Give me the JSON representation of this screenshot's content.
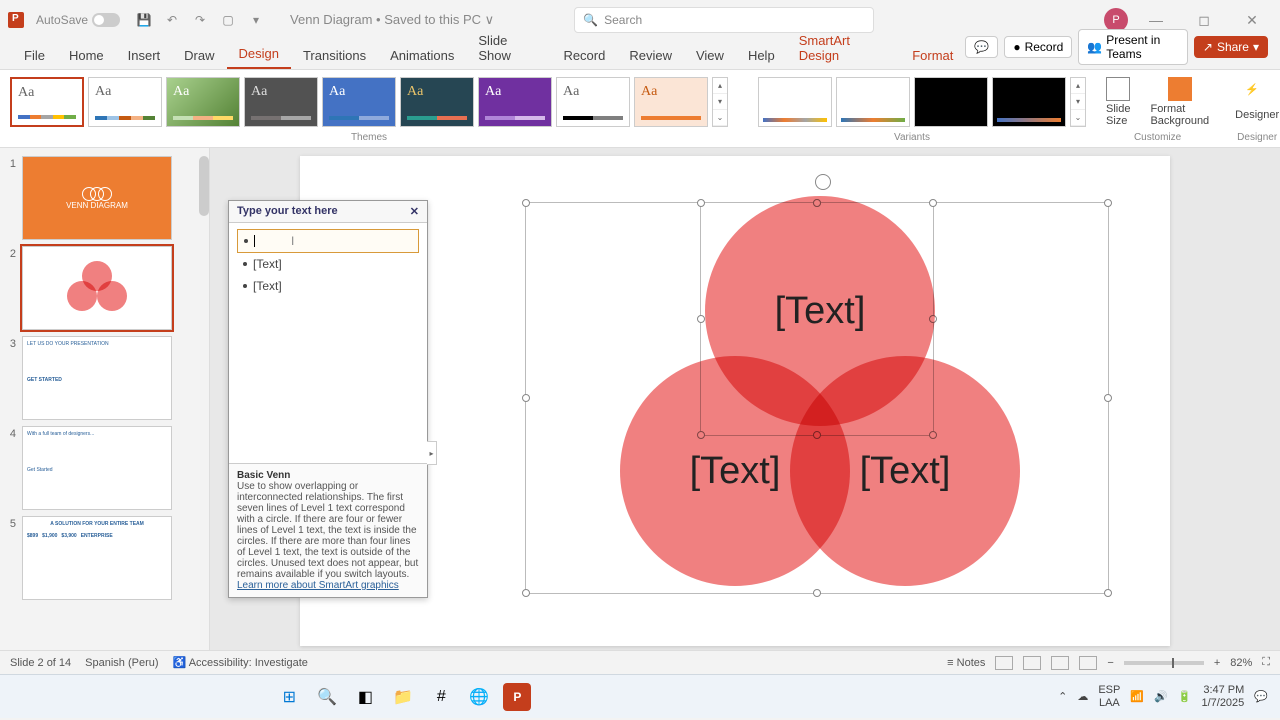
{
  "titlebar": {
    "autosave_label": "AutoSave",
    "doc_title": "Venn Diagram • Saved to this PC ∨",
    "search_placeholder": "Search",
    "user_initial": "P"
  },
  "ribbon": {
    "tabs": {
      "file": "File",
      "home": "Home",
      "insert": "Insert",
      "draw": "Draw",
      "design": "Design",
      "transitions": "Transitions",
      "animations": "Animations",
      "slideshow": "Slide Show",
      "record": "Record",
      "review": "Review",
      "view": "View",
      "help": "Help",
      "smartart": "SmartArt Design",
      "format": "Format"
    },
    "record_btn": "Record",
    "present_btn": "Present in Teams",
    "share_btn": "Share",
    "themes_label": "Themes",
    "variants_label": "Variants",
    "customize_label": "Customize",
    "designer_label": "Designer",
    "slide_size": "Slide Size",
    "format_bg": "Format Background",
    "designer_btn": "Designer",
    "aa": "Aa"
  },
  "text_pane": {
    "title": "Type your text here",
    "item2": "[Text]",
    "item3": "[Text]",
    "desc_title": "Basic Venn",
    "desc_body": "Use to show overlapping or interconnected relationships. The first seven lines of Level 1 text correspond with a circle. If there are four or fewer lines of Level 1 text, the text is inside the circles. If there are more than four lines of Level 1 text, the text is outside of the circles. Unused text does not appear, but remains available if you switch layouts.",
    "learn_more": "Learn more about SmartArt graphics"
  },
  "venn": {
    "c1": "[Text]",
    "c2": "[Text]",
    "c3": "[Text]"
  },
  "thumbs": {
    "n1": "1",
    "n2": "2",
    "n3": "3",
    "n4": "4",
    "n5": "5",
    "t1_title": "VENN DIAGRAM",
    "t3a": "LET US DO YOUR PRESENTATION",
    "t3b": "GET STARTED",
    "t4a": "With a full team of designers...",
    "t4b": "Get Started",
    "t5a": "A SOLUTION FOR YOUR ENTIRE TEAM",
    "t5b": "$899",
    "t5c": "$1,900",
    "t5d": "$3,900",
    "t5e": "ENTERPRISE"
  },
  "statusbar": {
    "slide": "Slide 2 of 14",
    "lang": "Spanish (Peru)",
    "access": "Accessibility: Investigate",
    "notes": "Notes",
    "zoom": "82%"
  },
  "tray": {
    "lang": "ESP",
    "kb": "LAA",
    "time": "3:47 PM",
    "date": "1/7/2025"
  }
}
